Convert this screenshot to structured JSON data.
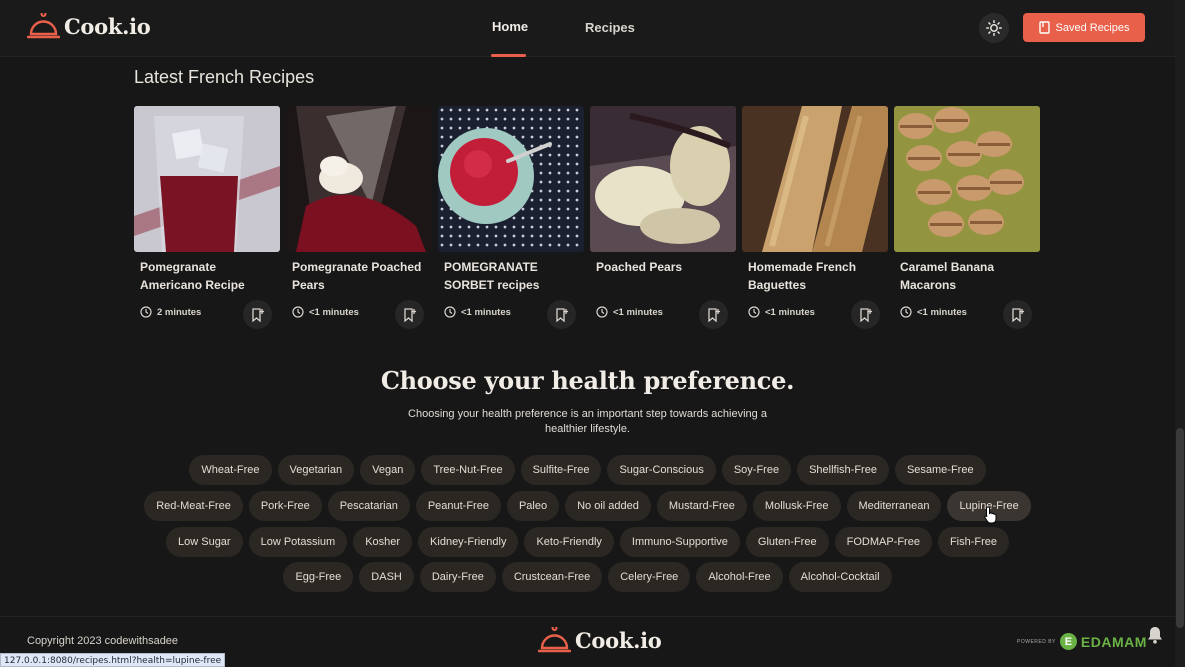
{
  "header": {
    "brand": "Cook.io",
    "nav": [
      {
        "label": "Home",
        "active": true
      },
      {
        "label": "Recipes",
        "active": false
      }
    ],
    "theme_icon": "sun-icon",
    "saved_label": "Saved Recipes",
    "accent_color": "#e8604a"
  },
  "latest": {
    "title": "Latest French Recipes",
    "cards": [
      {
        "title": "Pomegranate Americano Recipe",
        "time": "2 minutes"
      },
      {
        "title": "Pomegranate Poached Pears",
        "time": "<1 minutes"
      },
      {
        "title": "POMEGRANATE SORBET recipes",
        "time": "<1 minutes"
      },
      {
        "title": "Poached Pears",
        "time": "<1 minutes"
      },
      {
        "title": "Homemade French Baguettes",
        "time": "<1 minutes"
      },
      {
        "title": "Caramel Banana Macarons",
        "time": "<1 minutes"
      }
    ]
  },
  "health": {
    "title": "Choose your health preference.",
    "subtitle": "Choosing your health preference is an important step towards achieving a healthier lifestyle.",
    "rows": [
      [
        "Wheat-Free",
        "Vegetarian",
        "Vegan",
        "Tree-Nut-Free",
        "Sulfite-Free",
        "Sugar-Conscious",
        "Soy-Free",
        "Shellfish-Free",
        "Sesame-Free"
      ],
      [
        "Red-Meat-Free",
        "Pork-Free",
        "Pescatarian",
        "Peanut-Free",
        "Paleo",
        "No oil added",
        "Mustard-Free",
        "Mollusk-Free",
        "Mediterranean",
        "Lupine-Free"
      ],
      [
        "Low Sugar",
        "Low Potassium",
        "Kosher",
        "Kidney-Friendly",
        "Keto-Friendly",
        "Immuno-Supportive",
        "Gluten-Free",
        "FODMAP-Free",
        "Fish-Free"
      ],
      [
        "Egg-Free",
        "DASH",
        "Dairy-Free",
        "Crustcean-Free",
        "Celery-Free",
        "Alcohol-Free",
        "Alcohol-Cocktail"
      ]
    ],
    "hovered": "Lupine-Free"
  },
  "footer": {
    "copyright": "Copyright 2023 codewithsadee",
    "brand": "Cook.io",
    "powered_by": "POWERED BY",
    "edamam": "EDAMAM"
  },
  "status_bar": {
    "url": "127.0.0.1:8080/recipes.html?health=lupine-free"
  }
}
